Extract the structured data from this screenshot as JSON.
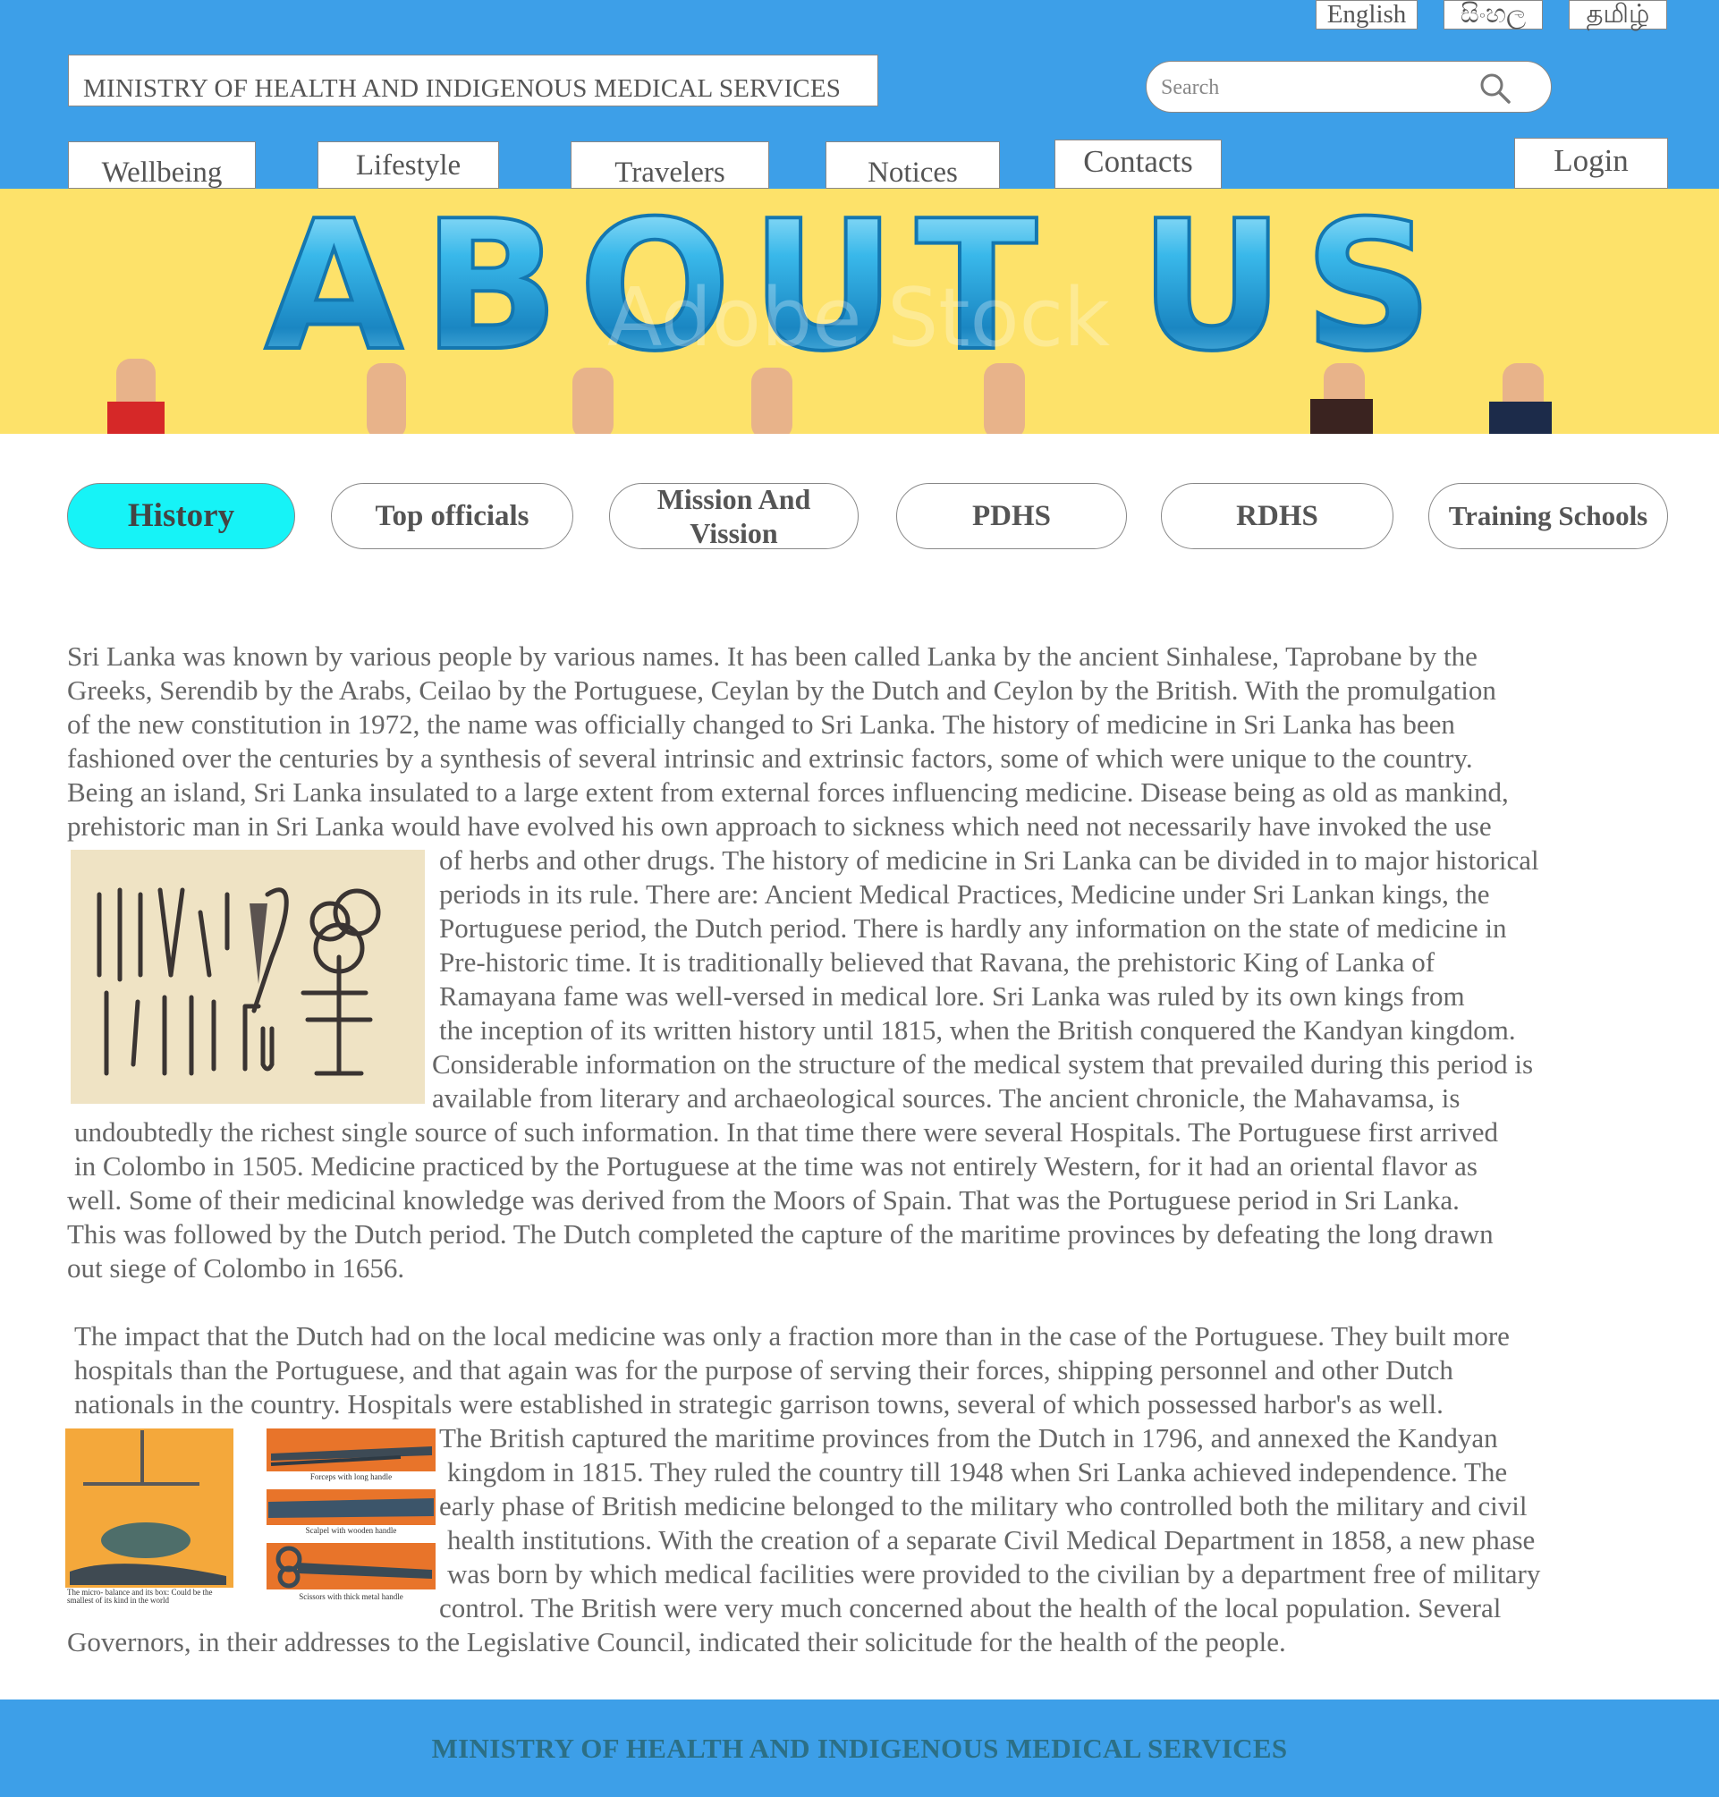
{
  "header": {
    "languages": [
      "English",
      "සිංහල",
      "தமிழ்"
    ],
    "site_title": "MINISTRY OF HEALTH AND INDIGENOUS MEDICAL SERVICES",
    "search": {
      "placeholder": "Search"
    },
    "nav": [
      "Wellbeing",
      "Lifestyle",
      "Travelers",
      "Notices",
      "Contacts"
    ],
    "login_label": "Login"
  },
  "banner": {
    "heading": "ABOUT US",
    "watermark": "Adobe Stock"
  },
  "tabs": [
    {
      "label": "History",
      "active": true
    },
    {
      "label": "Top officials",
      "active": false
    },
    {
      "label": "Mission And\nVission",
      "active": false
    },
    {
      "label": "PDHS",
      "active": false
    },
    {
      "label": "RDHS",
      "active": false
    },
    {
      "label": "Training Schools",
      "active": false
    }
  ],
  "content": {
    "paragraph1_lines": [
      "Sri Lanka was known by various people by various names. It has been called Lanka by the ancient Sinhalese, Taprobane by the",
      "Greeks, Serendib by the Arabs, Ceilao by the Portuguese, Ceylan by the Dutch and Ceylon by the British. With the promulgation",
      "of the new constitution in 1972, the name was officially changed to Sri Lanka. The history of medicine in Sri Lanka has been",
      "fashioned over the centuries by a synthesis of several intrinsic and extrinsic factors, some of which were unique to the country.",
      "Being an island, Sri Lanka insulated to a large extent from external forces influencing medicine. Disease being as old as mankind,",
      "prehistoric man in Sri Lanka would have evolved his own approach to sickness which need not necessarily have invoked the use",
      "of herbs and other drugs. The history of medicine in Sri Lanka can be divided in to major historical",
      "periods in its rule. There are: Ancient Medical Practices, Medicine under Sri Lankan kings, the",
      "Portuguese period, the Dutch period. There is hardly any information on the state of medicine in",
      "Pre-historic time. It is traditionally believed that Ravana, the prehistoric King of Lanka of",
      "Ramayana fame was well-versed in medical lore. Sri Lanka was ruled by its own kings from",
      "the inception of its written history until 1815, when the British conquered the Kandyan kingdom.",
      "Considerable information on the structure of the medical system that prevailed during this period is",
      "available from literary and archaeological sources. The ancient chronicle, the Mahavamsa, is",
      "undoubtedly the richest single source of such information. In that time there were several Hospitals. The Portuguese first arrived",
      "in Colombo in 1505. Medicine practiced by the Portuguese at the time was not entirely Western, for it had an oriental flavor as",
      "well. Some of their medicinal knowledge was derived from the Moors of Spain. That was the Portuguese period in Sri Lanka.",
      "This was followed by the Dutch period. The Dutch completed the capture of the maritime provinces by defeating the long drawn",
      "out siege of Colombo in 1656."
    ],
    "paragraph2_lines": [
      "The impact that the Dutch had on the local medicine was only a fraction more than in the case of the Portuguese. They built more",
      "hospitals than the Portuguese, and that again was for the purpose of serving their forces, shipping personnel and other Dutch",
      "nationals in the country. Hospitals were established in strategic garrison towns, several of which possessed harbor's as well.",
      "The British captured the maritime provinces from the Dutch in 1796, and annexed the Kandyan",
      "kingdom in 1815. They ruled the country till 1948 when Sri Lanka achieved independence. The",
      "early phase of British medicine belonged to the military who controlled both the military and civil",
      "health institutions. With the creation of a separate Civil Medical Department in 1858, a new phase",
      "was born by which medical facilities were provided to the civilian by a department free of military",
      "control. The British were very much concerned about the health of the local population. Several",
      "Governors, in their addresses to the Legislative Council, indicated their solicitude for the health of the people."
    ],
    "image_captions": {
      "balance": "The micro- balance and its box: Could be the smallest of its kind in the world",
      "forceps": "Forceps with long handle",
      "scalpel": "Scalpel with wooden handle",
      "scissors": "Scissors with thick metal handle"
    }
  },
  "footer": {
    "title": "MINISTRY OF HEALTH AND INDIGENOUS MEDICAL SERVICES"
  },
  "colors": {
    "header_bg": "#3d9fe8",
    "banner_bg": "#fde26a",
    "active_tab": "#16f3f7",
    "footer_text": "#2b6f86"
  }
}
